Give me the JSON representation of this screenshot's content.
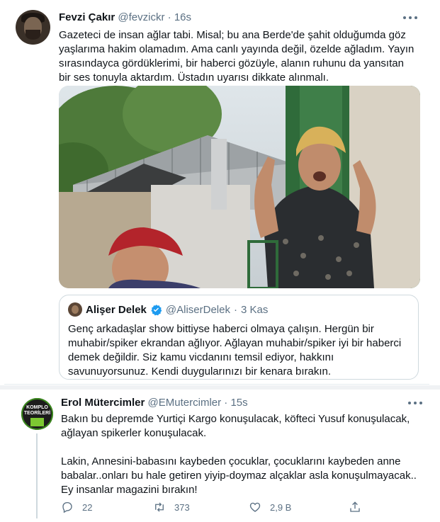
{
  "tweet1": {
    "name": "Fevzi Çakır",
    "handle": "@fevzickr",
    "separator": "·",
    "time": "16s",
    "avatar_icon": "user-avatar",
    "text": "Gazeteci de insan ağlar tabi. Misal; bu ana Berde'de şahit olduğumda göz yaşlarıma hakim olamadım. Ama canlı yayında değil, özelde ağladım. Yayın sırasındayca gördüklerimi, bir haberci gözüyle, alanın ruhunu da yansıtan bir ses tonuyla aktardım. Üstadın uyarısı dikkate alınmalı.",
    "quote": {
      "name": "Alişer Delek",
      "handle": "@AliserDelek",
      "separator": "·",
      "time": "3 Kas",
      "verified_color": "#1d9bf0",
      "text": "Genç arkadaşlar show bittiyse haberci olmaya çalışın. Hergün bir muhabir/spiker  ekrandan ağlıyor. Ağlayan muhabir/spiker iyi bir haberci demek değildir. Siz kamu vicdanını temsil ediyor, hakkını savunuyorsunuz. Kendi duygularınızı bir kenara bırakın."
    }
  },
  "tweet2": {
    "name": "Erol Mütercimler",
    "handle": "@EMutercimler",
    "separator": "·",
    "time": "15s",
    "avatar_label": "KOMPLO TEORİLERİ",
    "paragraph1": "Bakın bu depremde Yurtiçi Kargo konuşulacak, köfteci Yusuf konuşulacak, ağlayan spikerler konuşulacak.",
    "paragraph2": "Lakin, Annesini-babasını kaybeden çocuklar, çocuklarını kaybeden anne babalar..onları bu hale getiren yiyip-doymaz alçaklar asla konuşulmayacak.. Ey insanlar magazini bırakın!",
    "actions": {
      "reply_count": "22",
      "retweet_count": "373",
      "like_count": "2,9 B"
    }
  },
  "colors": {
    "text": "#0f1419",
    "muted": "#5b7083",
    "border": "#cfd9de",
    "accent": "#1d9bf0"
  }
}
